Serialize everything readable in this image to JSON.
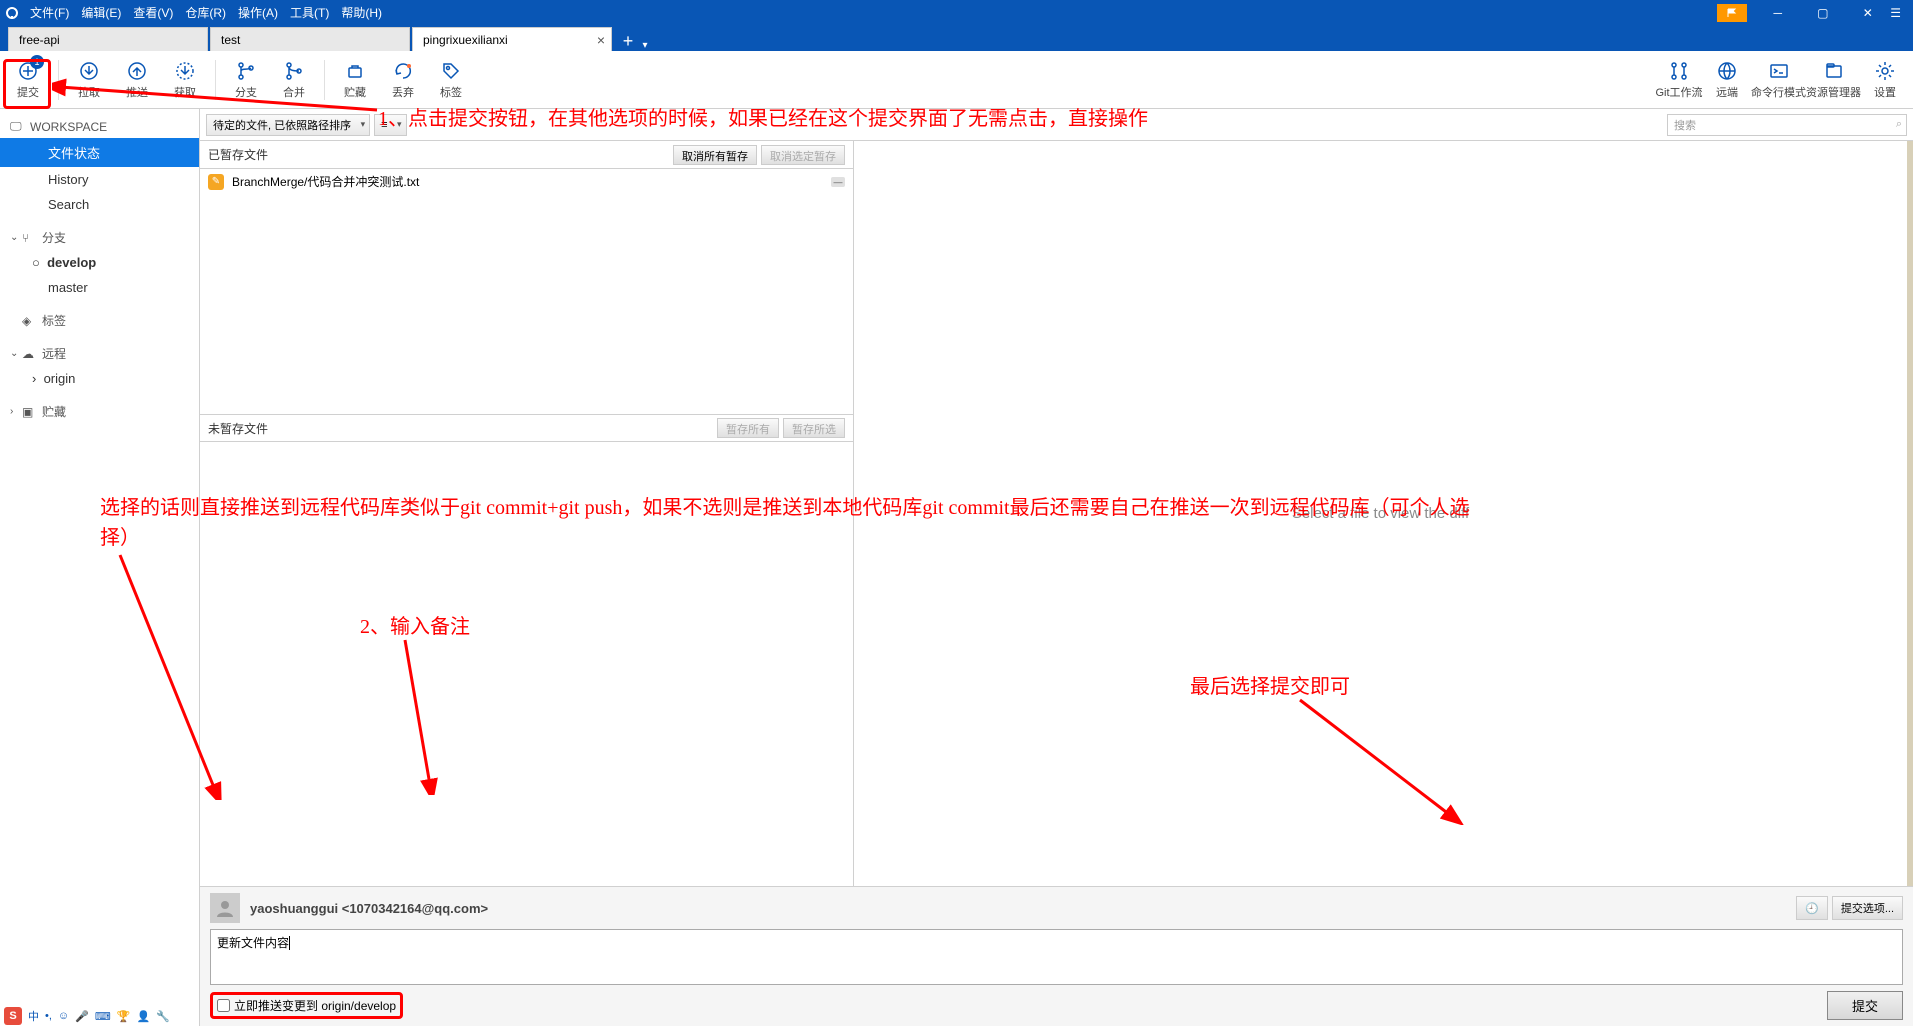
{
  "menu": {
    "file": "文件(F)",
    "edit": "编辑(E)",
    "view": "查看(V)",
    "repo": "仓库(R)",
    "action": "操作(A)",
    "tool": "工具(T)",
    "help": "帮助(H)"
  },
  "tabs": {
    "t1": "free-api",
    "t2": "test",
    "t3": "pingrixuexilianxi"
  },
  "toolbar": {
    "commit": "提交",
    "pull": "拉取",
    "push": "推送",
    "fetch": "获取",
    "branch": "分支",
    "merge": "合并",
    "stash": "贮藏",
    "discard": "丢弃",
    "tag": "标签",
    "gitflow": "Git工作流",
    "remote": "远端",
    "terminal": "命令行模式",
    "explorer": "资源管理器",
    "settings": "设置",
    "commit_badge": "1"
  },
  "sidebar": {
    "workspace": "WORKSPACE",
    "file_status": "文件状态",
    "history": "History",
    "search": "Search",
    "branches": "分支",
    "branch_develop": "develop",
    "branch_master": "master",
    "tags": "标签",
    "remotes": "远程",
    "remote_origin": "origin",
    "stashes": "贮藏"
  },
  "content": {
    "sort_dropdown": "待定的文件, 已依照路径排序",
    "view_mode": "≡",
    "search_placeholder": "搜索",
    "staged_header": "已暂存文件",
    "unstage_all": "取消所有暂存",
    "unstage_selected": "取消选定暂存",
    "file1": "BranchMerge/代码合并冲突测试.txt",
    "unstaged_header": "未暂存文件",
    "stage_all": "暂存所有",
    "stage_selected": "暂存所选",
    "diff_placeholder": "Select a file to view the diff"
  },
  "commit": {
    "user": "yaoshuanggui <1070342164@qq.com>",
    "options": "提交选项...",
    "message": "更新文件内容",
    "push_checkbox": "立即推送变更到 origin/develop",
    "submit": "提交"
  },
  "annotations": {
    "a1": "1、点击提交按钮，在其他选项的时候，如果已经在这个提交界面了无需点击，直接操作",
    "a2": "选择的话则直接推送到远程代码库类似于git commit+git push，如果不选则是推送到本地代码库git commit最后还需要自己在推送一次到远程代码库（可个人选择）",
    "a3": "2、输入备注",
    "a4": "最后选择提交即可"
  },
  "taskbar": {
    "ime": "中"
  }
}
